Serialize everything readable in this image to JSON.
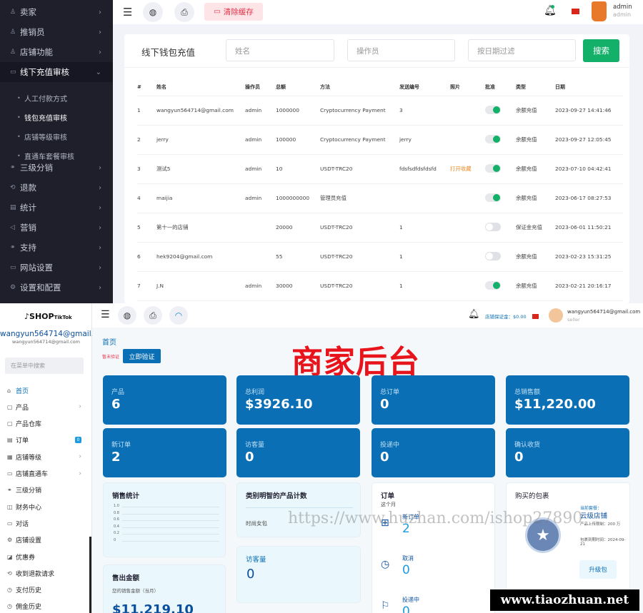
{
  "admin": {
    "sidebar": [
      {
        "label": "卖家",
        "icon": "user-icon",
        "chev": "›"
      },
      {
        "label": "推销员",
        "icon": "user-icon",
        "chev": "›"
      },
      {
        "label": "店铺功能",
        "icon": "user-icon",
        "chev": "›"
      },
      {
        "label": "线下充值审核",
        "icon": "wallet-icon",
        "chev": "⌄"
      },
      {
        "label": "三级分销",
        "icon": "link-icon",
        "chev": "›"
      },
      {
        "label": "退款",
        "icon": "refund-icon",
        "chev": "›"
      },
      {
        "label": "统计",
        "icon": "doc-icon",
        "chev": "›"
      },
      {
        "label": "营销",
        "icon": "megaphone-icon",
        "chev": "›"
      },
      {
        "label": "支持",
        "icon": "link-icon",
        "chev": "›"
      },
      {
        "label": "网站设置",
        "icon": "monitor-icon",
        "chev": "›"
      },
      {
        "label": "设置和配置",
        "icon": "gear-icon",
        "chev": "›"
      }
    ],
    "subitems": [
      "人工付款方式",
      "钱包充值审核",
      "店铺等级审核",
      "直通车套餐审核"
    ],
    "header": {
      "clear_cache": "清除缓存",
      "user_name": "admin",
      "user_role": "admin"
    },
    "panel_title": "线下钱包充值",
    "filters": {
      "name": "姓名",
      "operator": "操作员",
      "date": "按日期过滤",
      "search": "搜索"
    },
    "columns": [
      "#",
      "姓名",
      "操作员",
      "总额",
      "方法",
      "发送编号",
      "照片",
      "批准",
      "类型",
      "日期"
    ],
    "rows": [
      {
        "n": "1",
        "name": "wangyun564714@gmail.com",
        "op": "admin",
        "amt": "1000000",
        "method": "Cryptocurrency Payment",
        "sid": "3",
        "photo": "",
        "on": true,
        "type": "余额充值",
        "date": "2023-09-27 14:41:46"
      },
      {
        "n": "2",
        "name": "jerry",
        "op": "admin",
        "amt": "100000",
        "method": "Cryptocurrency Payment",
        "sid": "jerry",
        "photo": "",
        "on": true,
        "type": "余额充值",
        "date": "2023-09-27 12:05:45"
      },
      {
        "n": "3",
        "name": "测试5",
        "op": "admin",
        "amt": "10",
        "method": "USDT-TRC20",
        "sid": "fdsfsdfdsfdsfd",
        "photo": "打开收藏",
        "on": true,
        "type": "余额充值",
        "date": "2023-07-10 04:42:41"
      },
      {
        "n": "4",
        "name": "maijia",
        "op": "admin",
        "amt": "1000000000",
        "method": "管理员充值",
        "sid": "",
        "photo": "",
        "on": true,
        "type": "余额充值",
        "date": "2023-06-17 08:27:53"
      },
      {
        "n": "5",
        "name": "第十一的店铺",
        "op": "",
        "amt": "20000",
        "method": "USDT-TRC20",
        "sid": "1",
        "photo": "",
        "on": false,
        "type": "保证金充值",
        "date": "2023-06-01 11:50:21"
      },
      {
        "n": "6",
        "name": "hek9204@gmail.com",
        "op": "",
        "amt": "55",
        "method": "USDT-TRC20",
        "sid": "1",
        "photo": "",
        "on": false,
        "type": "余额充值",
        "date": "2023-02-23 15:31:25"
      },
      {
        "n": "7",
        "name": "J.N",
        "op": "admin",
        "amt": "30000",
        "method": "USDT-TRC20",
        "sid": "1",
        "photo": "",
        "on": true,
        "type": "余额充值",
        "date": "2023-02-21 20:16:17"
      }
    ]
  },
  "merchant": {
    "logo": "SHOP",
    "logo_sub": "TikTok",
    "user_email": "wangyun564714@gmail.c",
    "user_email_sub": "wangyun564714@gmail.com",
    "search_placeholder": "在菜单中搜索",
    "sidebar": [
      {
        "label": "首页",
        "icon": "home-icon",
        "chev": "",
        "badge": ""
      },
      {
        "label": "产品",
        "icon": "box-icon",
        "chev": "›",
        "badge": ""
      },
      {
        "label": "产品仓库",
        "icon": "box-icon",
        "chev": "",
        "badge": ""
      },
      {
        "label": "订单",
        "icon": "order-icon",
        "chev": "",
        "badge": "0"
      },
      {
        "label": "店铺等级",
        "icon": "shop-icon",
        "chev": "›",
        "badge": ""
      },
      {
        "label": "店铺直通车",
        "icon": "car-icon",
        "chev": "›",
        "badge": ""
      },
      {
        "label": "三级分销",
        "icon": "link-icon",
        "chev": "",
        "badge": ""
      },
      {
        "label": "财务中心",
        "icon": "finance-icon",
        "chev": "",
        "badge": ""
      },
      {
        "label": "对话",
        "icon": "chat-icon",
        "chev": "",
        "badge": ""
      },
      {
        "label": "店铺设置",
        "icon": "gear-icon",
        "chev": "",
        "badge": ""
      },
      {
        "label": "优惠券",
        "icon": "coupon-icon",
        "chev": "",
        "badge": ""
      },
      {
        "label": "收到退款请求",
        "icon": "refund-icon",
        "chev": "",
        "badge": ""
      },
      {
        "label": "支付历史",
        "icon": "history-icon",
        "chev": "",
        "badge": ""
      },
      {
        "label": "佣金历史",
        "icon": "history-icon",
        "chev": "",
        "badge": ""
      }
    ],
    "header": {
      "deposit": "店铺保证金：$0.00",
      "user_email": "wangyun564714@gmail.com",
      "user_role": "seller"
    },
    "breadcrumb": "首页",
    "unverified": "暂未验证",
    "verify_button": "立即验证",
    "banner": "商家后台",
    "kpis": [
      {
        "label": "产品",
        "value": "6"
      },
      {
        "label": "总利润",
        "value": "$3926.10"
      },
      {
        "label": "总订单",
        "value": "0"
      },
      {
        "label": "总销售额",
        "value": "$11,220.00"
      },
      {
        "label": "新订单",
        "value": "2"
      },
      {
        "label": "访客量",
        "value": "0"
      },
      {
        "label": "投递中",
        "value": "0"
      },
      {
        "label": "确认收货",
        "value": "0"
      }
    ],
    "sales_title": "销售统计",
    "sales_ticks": [
      "1.0",
      "0.8",
      "0.6",
      "0.4",
      "0.2",
      "0"
    ],
    "category_title": "类别明智的产品计数",
    "category_item": "时尚女包",
    "visitors_title": "访客量",
    "visitors_value": "0",
    "sold_title": "售出金额",
    "sold_sub": "您的销售金额（当月）",
    "sold_value": "$11,219.10",
    "orders_title": "订单",
    "orders_sub": "这个月",
    "orders": [
      {
        "label": "新订单",
        "value": "2"
      },
      {
        "label": "取消",
        "value": "0"
      },
      {
        "label": "投递中",
        "value": "0"
      }
    ],
    "package_title": "购买的包裹",
    "package_current": "当前套餐：",
    "package_name": "云级店铺",
    "package_desc": "产品上传限制：200 万",
    "package_expiry": "包裹到期时间：2024-09-21",
    "upgrade_button": "升级包"
  },
  "watermarks": {
    "w1": "https://www.huzhan.com/ishop27890",
    "w2": "www.tiaozhuan.net"
  },
  "colors": {
    "dark_sidebar": "#1e1f2b",
    "accent_green": "#13b06a",
    "merchant_blue": "#0a6fb4",
    "banner_red": "#e8141b"
  }
}
